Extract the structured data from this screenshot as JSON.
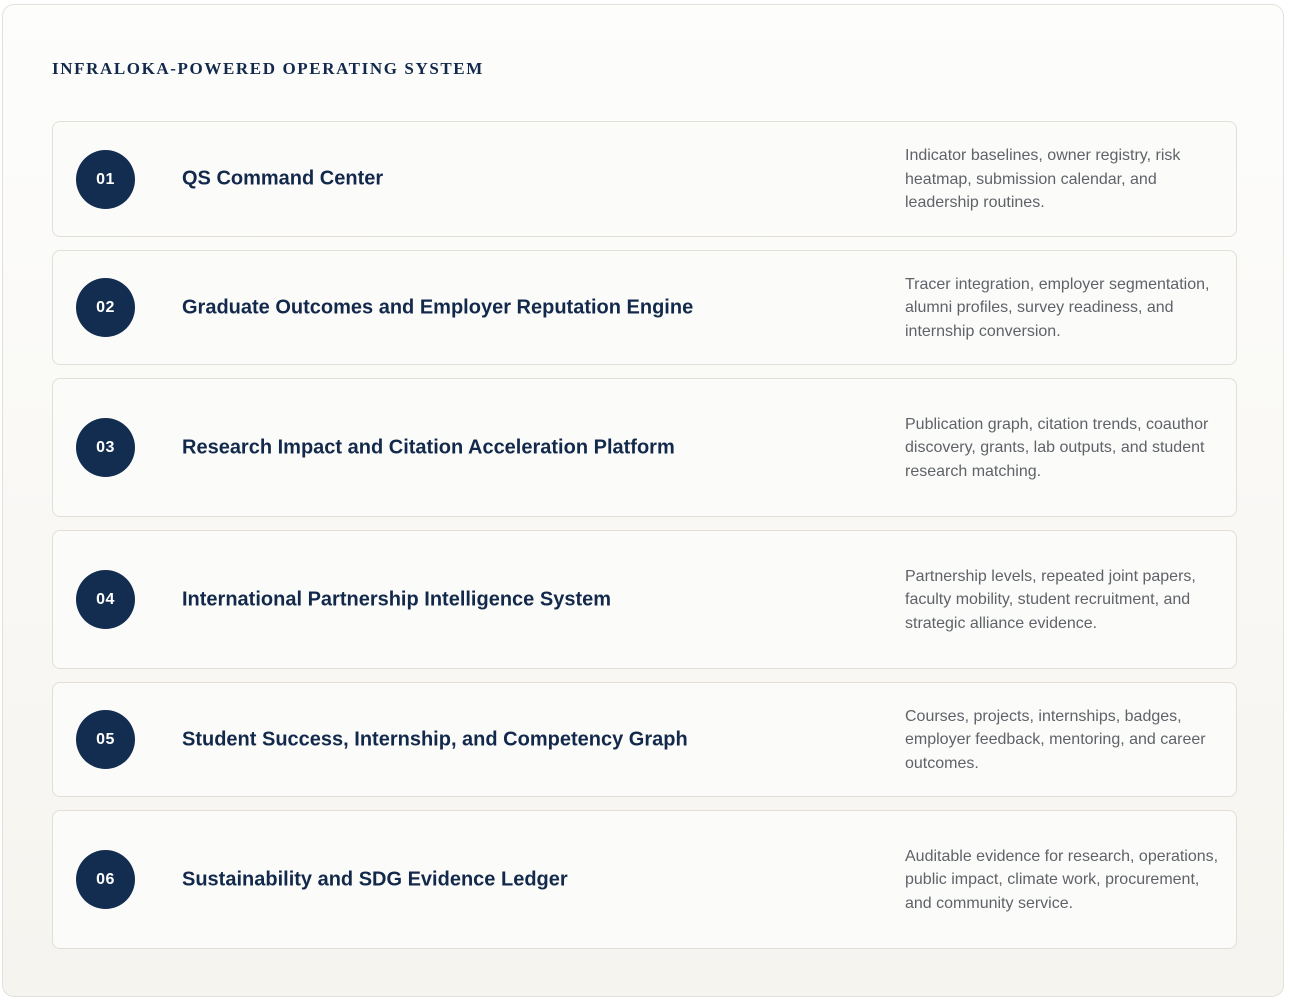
{
  "section": {
    "title": "INFRALOKA-POWERED OPERATING SYSTEM"
  },
  "modules": [
    {
      "number": "01",
      "title": "QS Command Center",
      "description": "Indicator baselines, owner registry, risk heatmap, submission calendar, and leadership routines."
    },
    {
      "number": "02",
      "title": "Graduate Outcomes and Employer Reputation Engine",
      "description": "Tracer integration, employer segmentation, alumni profiles, survey readiness, and internship conversion."
    },
    {
      "number": "03",
      "title": "Research Impact and Citation Acceleration Platform",
      "description": "Publication graph, citation trends, coauthor discovery, grants, lab outputs, and student research matching."
    },
    {
      "number": "04",
      "title": "International Partnership Intelligence System",
      "description": "Partnership levels, repeated joint papers, faculty mobility, student recruitment, and strategic alliance evidence."
    },
    {
      "number": "05",
      "title": "Student Success, Internship, and Competency Graph",
      "description": "Courses, projects, internships, badges, employer feedback, mentoring, and career outcomes."
    },
    {
      "number": "06",
      "title": "Sustainability and SDG Evidence Ledger",
      "description": "Auditable evidence for research, operations, public impact, climate work, procurement, and community service."
    }
  ],
  "colors": {
    "accent": "#132d51",
    "title_text": "#13294b",
    "body_text": "#5f6368",
    "card_border": "#e2dfd8"
  }
}
